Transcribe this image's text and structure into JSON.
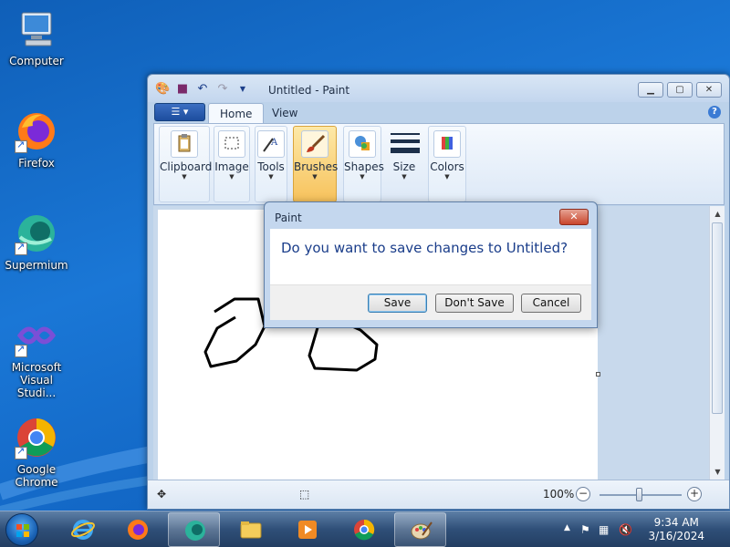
{
  "desktop": {
    "icons": [
      {
        "label": "Computer"
      },
      {
        "label": "Firefox"
      },
      {
        "label": "Supermium"
      },
      {
        "label": "Microsoft Visual Studi..."
      },
      {
        "label": "Google Chrome"
      }
    ]
  },
  "window": {
    "title": "Untitled - Paint",
    "menu_button_glyph": "☰ ▾",
    "tabs": [
      {
        "label": "Home",
        "active": true
      },
      {
        "label": "View",
        "active": false
      }
    ],
    "help_glyph": "?",
    "ribbon_groups": [
      {
        "label": "Clipboard"
      },
      {
        "label": "Image"
      },
      {
        "label": "Tools"
      },
      {
        "label": "Brushes",
        "active": true
      },
      {
        "label": "Shapes"
      },
      {
        "label": "Size"
      },
      {
        "label": "Colors"
      }
    ],
    "status": {
      "zoom": "100%",
      "zoom_out": "−",
      "zoom_in": "+"
    }
  },
  "dialog": {
    "title": "Paint",
    "message": "Do you want to save changes to Untitled?",
    "buttons": {
      "save": "Save",
      "dont_save": "Don't Save",
      "cancel": "Cancel"
    }
  },
  "taskbar": {
    "clock_time": "9:34 AM",
    "clock_date": "3/16/2024"
  },
  "colors": {
    "accent": "#1a3d8a",
    "close_red": "#c9462c",
    "brushes_active": "#f7c25c"
  }
}
